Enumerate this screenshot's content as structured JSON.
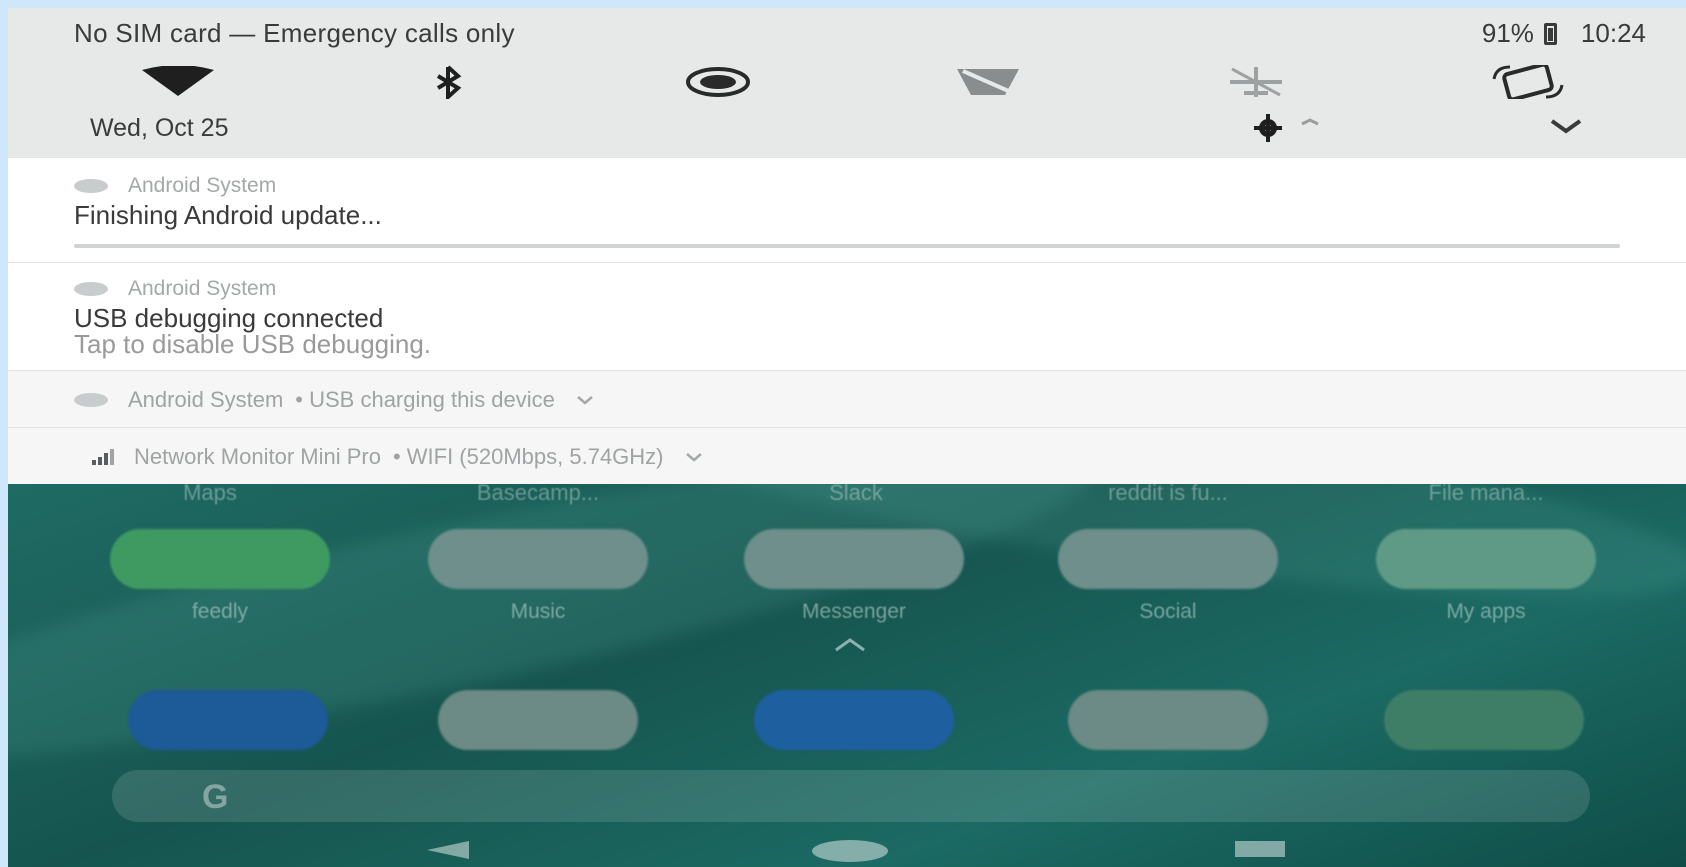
{
  "status_bar": {
    "carrier_text": "No SIM card — Emergency calls only",
    "battery_text": "91%",
    "time": "10:24"
  },
  "quick_settings": {
    "tiles": [
      "wifi-icon",
      "bluetooth-icon",
      "hotspot-icon",
      "no-sim-icon",
      "airplane-icon",
      "auto-rotate-icon"
    ],
    "date": "Wed, Oct 25"
  },
  "notifications": [
    {
      "app": "Android System",
      "title": "Finishing Android update...",
      "progress": 1.0
    },
    {
      "app": "Android System",
      "title": "USB debugging connected",
      "text": "Tap to disable USB debugging."
    },
    {
      "app": "Android System",
      "summary": "• USB charging this device"
    },
    {
      "app": "Network Monitor Mini Pro",
      "summary": "• WIFI (520Mbps, 5.74GHz)"
    }
  ],
  "home": {
    "top_labels": [
      "Maps",
      "Basecamp...",
      "Slack",
      "reddit is fu...",
      "File mana..."
    ],
    "apps": [
      {
        "label": "feedly",
        "color": "#3f9a62"
      },
      {
        "label": "Music",
        "color": "#6f8f8c"
      },
      {
        "label": "Messenger",
        "color": "#6f8f8c"
      },
      {
        "label": "Social",
        "color": "#6f8f8c"
      },
      {
        "label": "My apps",
        "color": "#5f9a86"
      }
    ],
    "dock": [
      {
        "name": "phone-icon",
        "color": "#1d5a98"
      },
      {
        "name": "gmail-icon",
        "color": "#6c8a86"
      },
      {
        "name": "messages-icon",
        "color": "#1e5fa0"
      },
      {
        "name": "camera-icon",
        "color": "#6c8a86"
      },
      {
        "name": "chrome-icon",
        "color": "#3f7e66"
      }
    ],
    "search_logo": "G"
  }
}
